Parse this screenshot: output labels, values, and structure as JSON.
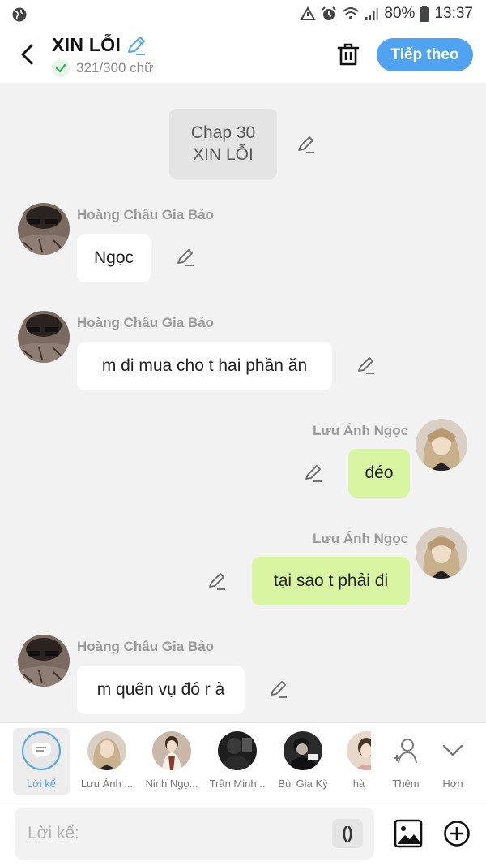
{
  "status": {
    "battery": "80%",
    "time": "13:37"
  },
  "header": {
    "title": "XIN LỖI",
    "word_count": "321/300 chữ",
    "next_label": "Tiếp theo"
  },
  "chapter": {
    "line1": "Chap 30",
    "line2": "XIN LỖI"
  },
  "messages": [
    {
      "sender": "Hoàng Châu Gia Bảo",
      "text": "Ngọc"
    },
    {
      "sender": "Hoàng Châu Gia Bảo",
      "text": "m đi mua cho t hai phần ăn"
    },
    {
      "sender": "Lưu Ánh Ngọc",
      "text": "đéo"
    },
    {
      "sender": "Lưu Ánh Ngọc",
      "text": "tại sao t phải đi"
    },
    {
      "sender": "Hoàng Châu Gia Bảo",
      "text": "m quên vụ đó r à"
    }
  ],
  "characters": [
    {
      "name": "Lời kể"
    },
    {
      "name": "Lưu Ánh ..."
    },
    {
      "name": "Ninh Ngọ..."
    },
    {
      "name": "Trần Minh..."
    },
    {
      "name": "Bùi Gia Kỳ"
    },
    {
      "name": "hà"
    },
    {
      "name": "Thêm"
    },
    {
      "name": "Hơn"
    }
  ],
  "input": {
    "placeholder": "Lời kể:",
    "paren_label": "()"
  },
  "colors": {
    "accent": "#4fa3f0",
    "right_bubble": "#d8f5a2",
    "left_bubble": "#ffffff",
    "background": "#f2f2f2"
  }
}
